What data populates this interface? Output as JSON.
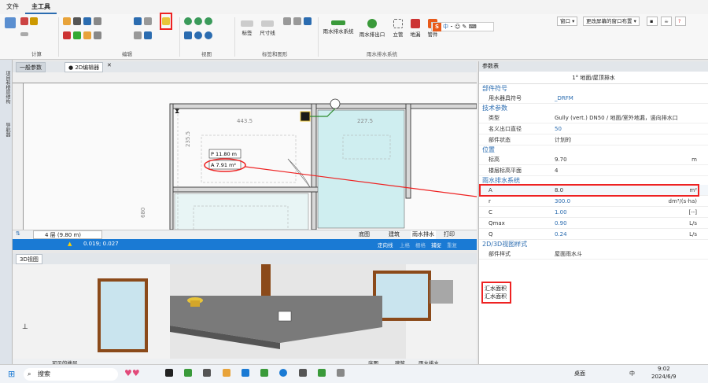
{
  "menu": {
    "file": "文件",
    "tools": "主工具"
  },
  "ribbon": {
    "groups": {
      "calc": "计算",
      "edit": "编辑",
      "view": "视图",
      "labels": "标签和图形",
      "drain": "雨水排水系统"
    },
    "buttons": {
      "tag": "标签",
      "dimension": "尺寸线",
      "rain_system": "雨水排水系统",
      "rain_outlet": "雨水排出口",
      "riser": "立管",
      "floor_drain": "地漏",
      "pipe": "管件"
    },
    "right_buttons": {
      "window": "窗口 ▾",
      "change_layout": "更改屏幕的窗口布置 ▾"
    },
    "ime": "中"
  },
  "left_strip": {
    "tab1": "项目和楼层结构",
    "tab2": "导航器"
  },
  "tabs": {
    "general": "一般参数",
    "editor2d": "● 2D编辑器"
  },
  "editor": {
    "dims": {
      "d1": "443.5",
      "d2": "227.5",
      "d3": "235.5",
      "d4": "680"
    },
    "label_p": "P  11.80 m",
    "label_a": "A  7.91  m²"
  },
  "viewbar": {
    "floor": "4 层 (9.80 m)",
    "tabs": [
      "底图",
      "建筑",
      "雨水排水",
      "打印"
    ]
  },
  "statusbar": {
    "coords": "0.019; 0.027",
    "items": [
      "定向线",
      "上格",
      "栅格",
      "捕捉",
      "重复"
    ]
  },
  "view3d": {
    "title": "3D视图",
    "bottom_left": "可见的楼层",
    "bottom_tabs": [
      "底图",
      "建筑",
      "雨水排水"
    ]
  },
  "props": {
    "title": "参数表",
    "element": "1° 地面/屋顶排水",
    "sections": {
      "symbol": "部件符号",
      "tech": "技术参数",
      "position": "位置",
      "rain": "雨水排水系统",
      "view": "2D/3D视图样式"
    },
    "rows": {
      "symbol_k": "用水器具符号",
      "symbol_v": "_DRFM",
      "type_k": "类型",
      "type_v": "Gully (vert.) DN50 / 地面/室外地漏，竖向排水口",
      "outlet_k": "名义出口直径",
      "outlet_v": "50",
      "state_k": "部件状态",
      "state_v": "计划的",
      "elev_k": "标高",
      "elev_v": "9.70",
      "elev_u": "m",
      "floor_k": "楼层标高平面",
      "floor_v": "4",
      "a_k": "A",
      "a_v": "8.0",
      "a_u": "m²",
      "r_k": "r",
      "r_v": "300.0",
      "r_u": "dm³/(s·ha)",
      "c_k": "C",
      "c_v": "1.00",
      "c_u": "[--]",
      "qmax_k": "Qmax",
      "qmax_v": "0.90",
      "qmax_u": "L/s",
      "q_k": "Q",
      "q_v": "0.24",
      "q_u": "L/s",
      "style_k": "部件样式",
      "style_v": "屋面雨水斗"
    },
    "note1": "汇水面积",
    "note2": "汇水面积"
  },
  "taskbar": {
    "search": "搜索",
    "desktop": "桌面",
    "ime": "中",
    "time": "9:02",
    "date": "2024/6/9"
  },
  "colors": {
    "accent": "#1a7ad4",
    "highlight": "#e22222",
    "pool": "#cfeef0"
  }
}
